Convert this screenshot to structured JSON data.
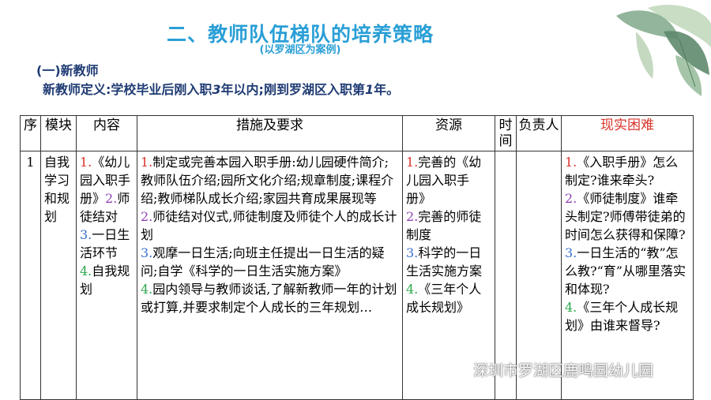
{
  "header": {
    "title": "二、教师队伍梯队的培养策略",
    "subtitle": "(以罗湖区为案例)"
  },
  "section": {
    "heading": "(一)新教师",
    "definition_prefix": "新教师定义:学校毕业后刚入职",
    "definition_num1": "3",
    "definition_mid": "年以内;刚到罗湖区入职第",
    "definition_num2": "1",
    "definition_suffix": "年。"
  },
  "table": {
    "headers": {
      "seq": "序",
      "module": "模块",
      "content": "内容",
      "measures": "措施及要求",
      "resources": "资源",
      "time": "时间",
      "owner": "负责人",
      "difficulty": "现实困难"
    },
    "row": {
      "seq": "1",
      "module": "自我学习和规划",
      "content": [
        {
          "num": "1.",
          "text": "《幼儿园入职手册》"
        },
        {
          "num": "2.",
          "text": "师徒结对"
        },
        {
          "num": "3.",
          "text": "一日生活环节"
        },
        {
          "num": "4.",
          "text": "自我规划"
        }
      ],
      "measures": [
        {
          "num": "1.",
          "text": "制定或完善本园入职手册:幼儿园硬件简介;教师队伍介绍;园所文化介绍;规章制度;课程介绍;教师梯队成长介绍;家园共育成果展现等"
        },
        {
          "num": "2.",
          "text": "师徒结对仪式,师徒制度及师徒个人的成长计划"
        },
        {
          "num": "3.",
          "text": "观摩一日生活;向班主任提出一日生活的疑问;自学《科学的一日生活实施方案》"
        },
        {
          "num": "4.",
          "text": "园内领导与教师谈话,了解新教师一年的计划或打算,并要求制定个人成长的三年规划…"
        }
      ],
      "resources": [
        {
          "num": "1.",
          "text": "完善的《幼儿园入职手册》"
        },
        {
          "num": "2.",
          "text": "完善的师徒制度"
        },
        {
          "num": "3.",
          "text": "科学的一日生活实施方案"
        },
        {
          "num": "4.",
          "text": "《三年个人成长规划》"
        }
      ],
      "time": "",
      "owner": "",
      "difficulty": [
        {
          "num": "1.",
          "text": "《入职手册》怎么制定?谁来牵头?"
        },
        {
          "num": "2.",
          "text": "《师徒制度》谁牵头制定?师傅带徒弟的时间怎么获得和保障?"
        },
        {
          "num": "3.",
          "text": "一日生活的“教”怎么教?“育”从哪里落实和体现?"
        },
        {
          "num": "4.",
          "text": "《三年个人成长规划》由谁来督导?"
        }
      ]
    }
  },
  "watermark": {
    "text": "深圳市罗湖区鹿鸣园幼儿园",
    "icon": "wechat-icon"
  },
  "colors": {
    "title": "#2a9fd6",
    "heading": "#1f3b73",
    "difficulty_header": "#d9342b",
    "item1": "#d9342b",
    "item2": "#8e3fb3",
    "item3": "#3b6fd1",
    "item4": "#2ea84f"
  }
}
